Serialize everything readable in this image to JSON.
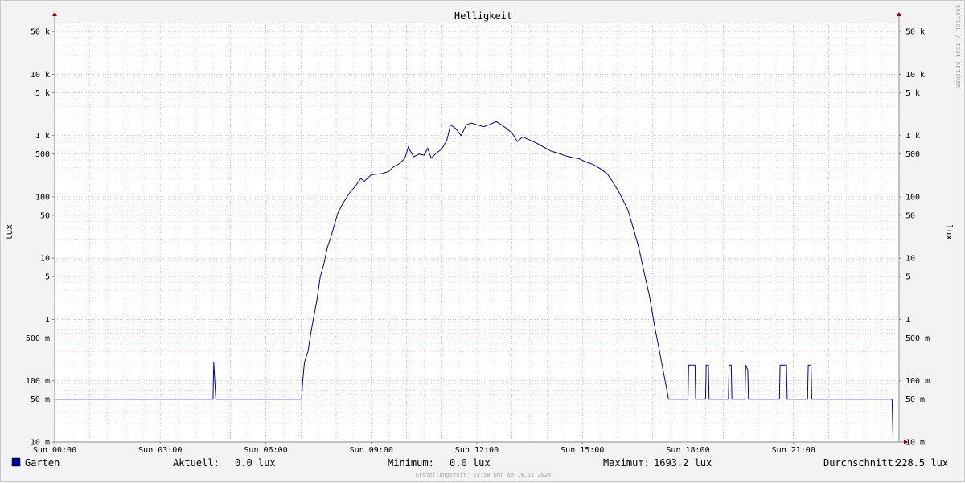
{
  "chart_data": {
    "type": "line",
    "title": "Helligkeit",
    "ylabel": "lux",
    "ylabel_right": "lux",
    "yscale": "log",
    "ylim": [
      0.01,
      70000
    ],
    "xlim_hours": [
      0,
      24
    ],
    "x_ticks": [
      "Sun 00:00",
      "Sun 03:00",
      "Sun 06:00",
      "Sun 09:00",
      "Sun 12:00",
      "Sun 15:00",
      "Sun 18:00",
      "Sun 21:00"
    ],
    "y_ticks": [
      {
        "value": 0.01,
        "label": "10 m"
      },
      {
        "value": 0.05,
        "label": "50 m"
      },
      {
        "value": 0.1,
        "label": "100 m"
      },
      {
        "value": 0.5,
        "label": "500 m"
      },
      {
        "value": 1,
        "label": "1"
      },
      {
        "value": 5,
        "label": "5"
      },
      {
        "value": 10,
        "label": "10"
      },
      {
        "value": 50,
        "label": "50"
      },
      {
        "value": 100,
        "label": "100"
      },
      {
        "value": 500,
        "label": "500"
      },
      {
        "value": 1000,
        "label": "1 k"
      },
      {
        "value": 5000,
        "label": "5 k"
      },
      {
        "value": 10000,
        "label": "10 k"
      },
      {
        "value": 50000,
        "label": "50 k"
      }
    ],
    "grid": true,
    "series": [
      {
        "name": "Garten",
        "color": "#000099",
        "points": [
          [
            0.0,
            0.05
          ],
          [
            4.5,
            0.05
          ],
          [
            4.52,
            0.2
          ],
          [
            4.58,
            0.05
          ],
          [
            7.02,
            0.05
          ],
          [
            7.05,
            0.1
          ],
          [
            7.1,
            0.2
          ],
          [
            7.2,
            0.3
          ],
          [
            7.28,
            0.6
          ],
          [
            7.35,
            1.0
          ],
          [
            7.45,
            2.0
          ],
          [
            7.55,
            5.0
          ],
          [
            7.65,
            8.0
          ],
          [
            7.75,
            15
          ],
          [
            7.85,
            22
          ],
          [
            7.95,
            35
          ],
          [
            8.05,
            55
          ],
          [
            8.2,
            80
          ],
          [
            8.4,
            120
          ],
          [
            8.55,
            150
          ],
          [
            8.7,
            200
          ],
          [
            8.8,
            180
          ],
          [
            9.0,
            230
          ],
          [
            9.3,
            240
          ],
          [
            9.5,
            260
          ],
          [
            9.6,
            300
          ],
          [
            9.8,
            350
          ],
          [
            9.95,
            420
          ],
          [
            10.05,
            650
          ],
          [
            10.2,
            450
          ],
          [
            10.35,
            500
          ],
          [
            10.5,
            480
          ],
          [
            10.6,
            620
          ],
          [
            10.7,
            430
          ],
          [
            10.85,
            520
          ],
          [
            11.0,
            600
          ],
          [
            11.15,
            850
          ],
          [
            11.25,
            1500
          ],
          [
            11.4,
            1300
          ],
          [
            11.55,
            1000
          ],
          [
            11.7,
            1500
          ],
          [
            11.85,
            1600
          ],
          [
            12.0,
            1500
          ],
          [
            12.2,
            1400
          ],
          [
            12.4,
            1550
          ],
          [
            12.55,
            1693
          ],
          [
            12.7,
            1500
          ],
          [
            12.85,
            1300
          ],
          [
            13.0,
            1100
          ],
          [
            13.15,
            800
          ],
          [
            13.3,
            950
          ],
          [
            13.5,
            850
          ],
          [
            13.7,
            750
          ],
          [
            13.9,
            650
          ],
          [
            14.1,
            560
          ],
          [
            14.3,
            520
          ],
          [
            14.5,
            470
          ],
          [
            14.7,
            440
          ],
          [
            14.9,
            420
          ],
          [
            15.1,
            370
          ],
          [
            15.3,
            340
          ],
          [
            15.5,
            290
          ],
          [
            15.7,
            240
          ],
          [
            15.85,
            180
          ],
          [
            16.0,
            130
          ],
          [
            16.15,
            90
          ],
          [
            16.3,
            60
          ],
          [
            16.45,
            30
          ],
          [
            16.6,
            15
          ],
          [
            16.75,
            6
          ],
          [
            16.9,
            2.5
          ],
          [
            17.05,
            0.8
          ],
          [
            17.15,
            0.4
          ],
          [
            17.25,
            0.2
          ],
          [
            17.35,
            0.1
          ],
          [
            17.45,
            0.05
          ],
          [
            18.0,
            0.05
          ],
          [
            18.02,
            0.18
          ],
          [
            18.2,
            0.18
          ],
          [
            18.22,
            0.05
          ],
          [
            18.5,
            0.05
          ],
          [
            18.52,
            0.18
          ],
          [
            18.58,
            0.18
          ],
          [
            18.6,
            0.05
          ],
          [
            19.15,
            0.05
          ],
          [
            19.17,
            0.18
          ],
          [
            19.23,
            0.18
          ],
          [
            19.25,
            0.05
          ],
          [
            19.62,
            0.05
          ],
          [
            19.64,
            0.18
          ],
          [
            19.7,
            0.15
          ],
          [
            19.72,
            0.05
          ],
          [
            20.6,
            0.05
          ],
          [
            20.62,
            0.18
          ],
          [
            20.8,
            0.18
          ],
          [
            20.82,
            0.05
          ],
          [
            21.4,
            0.05
          ],
          [
            21.42,
            0.18
          ],
          [
            21.5,
            0.18
          ],
          [
            21.52,
            0.05
          ],
          [
            23.8,
            0.05
          ],
          [
            23.83,
            0.01
          ]
        ]
      }
    ]
  },
  "legend": {
    "series_name": "Garten",
    "series_color": "#000099",
    "current_label": "Aktuell:",
    "current_value": "0.0 lux",
    "min_label": "Minimum:",
    "min_value": "0.0 lux",
    "max_label": "Maximum:",
    "max_value": "1693.2 lux",
    "avg_label": "Durchschnitt:",
    "avg_value": "228.5 lux"
  },
  "footer": "Erstellungszeit: 23:58 Uhr am 10.11.2024",
  "side_credit": "RRDTOOL / TOBI OETIKER",
  "colors": {
    "background": "#f3f3f3",
    "plot_background": "#ffffff",
    "major_grid": "#e8a0a0",
    "minor_grid": "#d8d8d8",
    "axis": "#888888",
    "arrow": "#990000",
    "line": "#000099"
  }
}
